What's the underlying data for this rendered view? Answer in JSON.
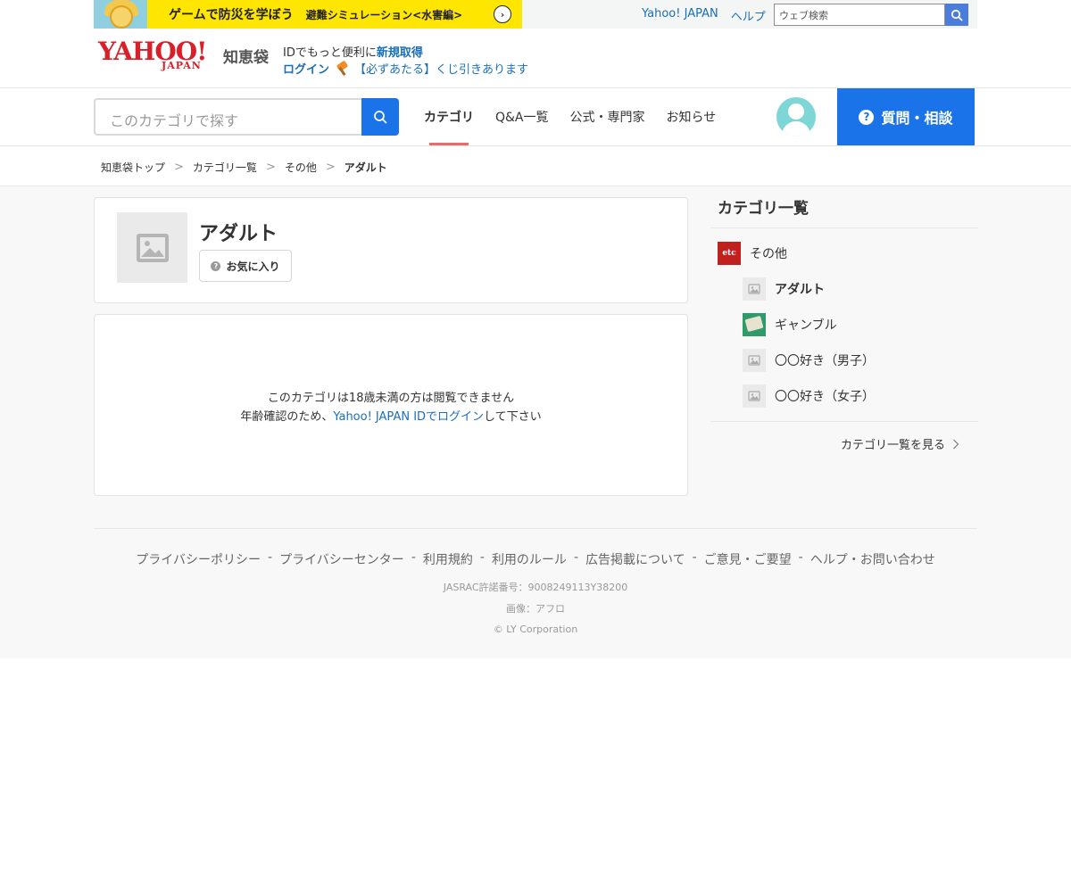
{
  "promo": {
    "headline": "ゲームで防災を学ぼう",
    "subline": "避難シミュレーション<水害編>"
  },
  "toplinks": [
    "Yahoo! JAPAN",
    "ヘルプ"
  ],
  "websearch": {
    "placeholder": "ウェブ検索"
  },
  "brand": {
    "logo": "YAHOO!",
    "logo_sub": "JAPAN",
    "service": "知恵袋"
  },
  "account": {
    "id_text": "IDでもっと便利に",
    "signup": "新規取得",
    "login": "ログイン",
    "campaign": "【必ずあたる】くじ引きあります"
  },
  "catsearch": {
    "placeholder": "このカテゴリで探す"
  },
  "nav": {
    "tabs": [
      "カテゴリ",
      "Q&A一覧",
      "公式・専門家",
      "お知らせ"
    ],
    "ask": "質問・相談"
  },
  "breadcrumb": [
    "知恵袋トップ",
    "カテゴリ一覧",
    "その他",
    "アダルト"
  ],
  "category": {
    "title": "アダルト",
    "favorite": "お気に入り"
  },
  "notice": {
    "line1": "このカテゴリは18歳未満の方は閲覧できません",
    "line2_pre": "年齢確認のため、",
    "line2_link": "Yahoo! JAPAN IDでログイン",
    "line2_post": "して下さい"
  },
  "sidebar": {
    "title": "カテゴリ一覧",
    "parent": {
      "label": "その他",
      "thumb": "etc"
    },
    "children": [
      "アダルト",
      "ギャンブル",
      "〇〇好き（男子）",
      "〇〇好き（女子）"
    ],
    "more": "カテゴリ一覧を見る"
  },
  "footer": {
    "links": [
      "プライバシーポリシー",
      "プライバシーセンター",
      "利用規約",
      "利用のルール",
      "広告掲載について",
      "ご意見・ご要望",
      "ヘルプ・お問い合わせ"
    ],
    "separator": "-",
    "jasrac": "JASRAC許諾番号：9008249113Y38200",
    "image_credit": "画像：アフロ",
    "copyright": "© LY Corporation"
  },
  "colors": {
    "accent_blue": "#1a73e8",
    "link_blue": "#1a6fb8",
    "brand_red": "#d81f2a",
    "active_tab_underline": "#e86b6b",
    "promo_yellow": "#ffe600"
  }
}
